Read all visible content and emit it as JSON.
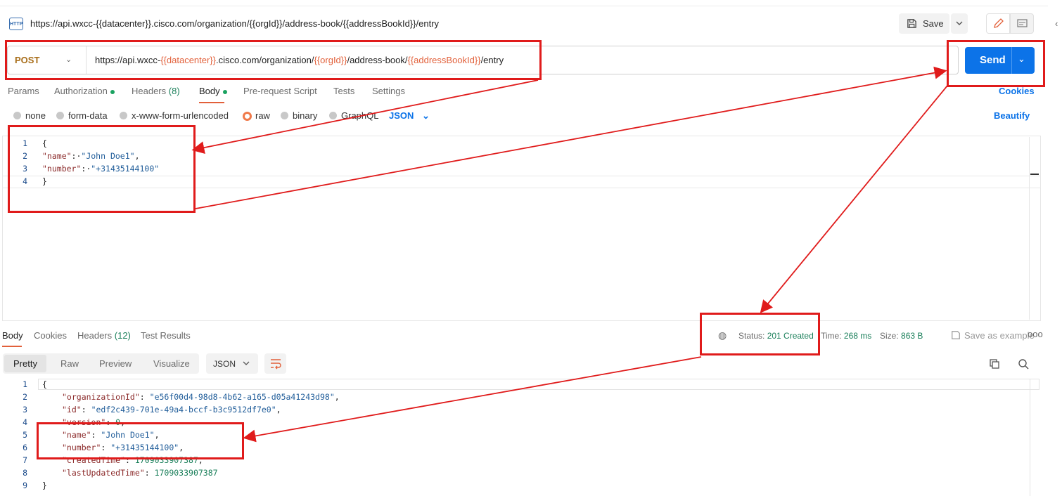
{
  "title_bar": {
    "icon_text": "HTTP",
    "title": "https://api.wxcc-{{datacenter}}.cisco.com/organization/{{orgId}}/address-book/{{addressBookId}}/entry",
    "save_label": "Save"
  },
  "request": {
    "method": "POST",
    "url_parts": {
      "p1": "https://api.wxcc-",
      "v1": "{{datacenter}}",
      "p2": ".cisco.com/organization/",
      "v2": "{{orgId}}",
      "p3": "/address-book/",
      "v3": "{{addressBookId}}",
      "p4": "/entry"
    },
    "send_label": "Send"
  },
  "request_tabs": {
    "params": "Params",
    "authorization": "Authorization",
    "headers": "Headers",
    "headers_count": "(8)",
    "body": "Body",
    "prerequest": "Pre-request Script",
    "tests": "Tests",
    "settings": "Settings",
    "cookies": "Cookies"
  },
  "body_types": {
    "none": "none",
    "form_data": "form-data",
    "urlencoded": "x-www-form-urlencoded",
    "raw": "raw",
    "binary": "binary",
    "graphql": "GraphQL",
    "format": "JSON",
    "beautify": "Beautify",
    "selected": "raw"
  },
  "request_body": {
    "line_numbers": [
      "1",
      "2",
      "3",
      "4"
    ],
    "open": "{",
    "name_key": "\"name\"",
    "name_val": "\"John Doe1\"",
    "number_key": "\"number\"",
    "number_val": "\"+31435144100\"",
    "close": "}"
  },
  "response_tabs": {
    "body": "Body",
    "cookies": "Cookies",
    "headers": "Headers",
    "headers_count": "(12)",
    "test_results": "Test Results"
  },
  "response_status": {
    "status_label": "Status:",
    "status_value": "201 Created",
    "time_label": "Time:",
    "time_value": "268 ms",
    "size_label": "Size:",
    "size_value": "863 B",
    "save_example": "Save as example",
    "more": "ooo"
  },
  "response_view": {
    "pretty": "Pretty",
    "raw": "Raw",
    "preview": "Preview",
    "visualize": "Visualize",
    "format": "JSON"
  },
  "response_body": {
    "line_numbers": [
      "1",
      "2",
      "3",
      "4",
      "5",
      "6",
      "7",
      "8",
      "9"
    ],
    "open": "{",
    "k_org": "\"organizationId\"",
    "v_org": "\"e56f00d4-98d8-4b62-a165-d05a41243d98\"",
    "k_id": "\"id\"",
    "v_id": "\"edf2c439-701e-49a4-bccf-b3c9512df7e0\"",
    "k_version": "\"version\"",
    "v_version": "0",
    "k_name": "\"name\"",
    "v_name": "\"John Doe1\"",
    "k_number": "\"number\"",
    "v_number": "\"+31435144100\"",
    "k_created": "\"createdTime\"",
    "v_created": "1709033907387",
    "k_updated": "\"lastUpdatedTime\"",
    "v_updated": "1709033907387",
    "close": "}"
  },
  "colors": {
    "accent_blue": "#0c73e8",
    "variable_orange": "#e2603a",
    "annotation_red": "#e01b1b",
    "status_green": "#1a7f5a"
  }
}
